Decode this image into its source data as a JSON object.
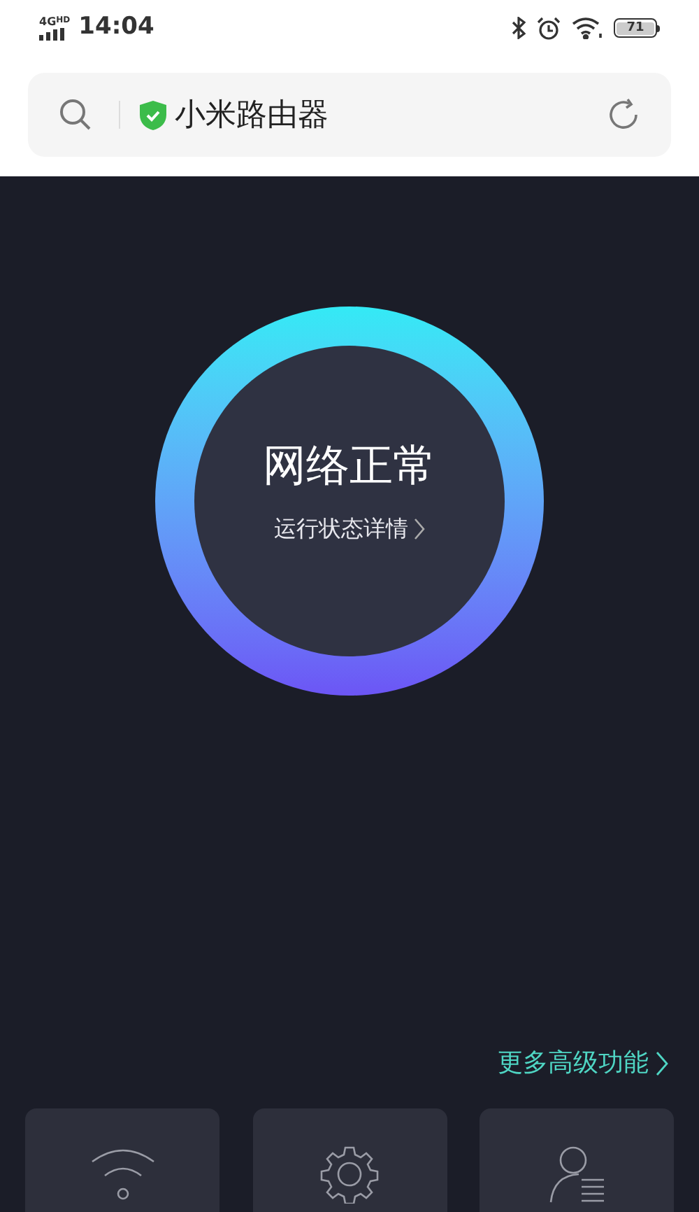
{
  "status_bar": {
    "network": "4G",
    "network_badge": "HD",
    "time": "14:04",
    "battery": "71"
  },
  "address_bar": {
    "secure": true,
    "title": "小米路由器"
  },
  "status": {
    "headline": "网络正常",
    "details_link": "运行状态详情"
  },
  "more_link": "更多高级功能",
  "tiles": [
    {
      "kind": "wifi"
    },
    {
      "kind": "settings"
    },
    {
      "kind": "users"
    }
  ]
}
